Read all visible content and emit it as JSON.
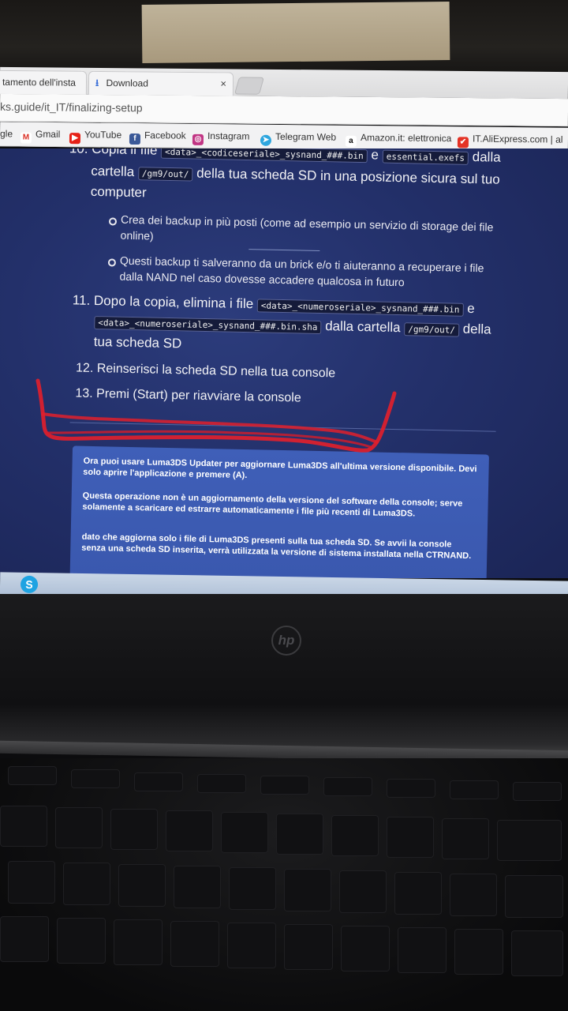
{
  "browser": {
    "tabs": [
      {
        "label": "tamento dell'insta"
      },
      {
        "label": "Download"
      }
    ],
    "tab_close_glyph": "×",
    "url": "ks.guide/it_IT/finalizing-setup",
    "bookmarks": [
      {
        "label": "gle",
        "icon": "google-icon"
      },
      {
        "label": "Gmail",
        "icon": "gmail-icon",
        "glyph": "M"
      },
      {
        "label": "YouTube",
        "icon": "youtube-icon"
      },
      {
        "label": "Facebook",
        "icon": "facebook-icon",
        "glyph": "f"
      },
      {
        "label": "Instagram",
        "icon": "instagram-icon"
      },
      {
        "label": "Telegram Web",
        "icon": "telegram-icon"
      },
      {
        "label": "Amazon.it: elettronica",
        "icon": "amazon-icon",
        "glyph": "a"
      },
      {
        "label": "IT.AliExpress.com | al",
        "icon": "aliexpress-icon"
      }
    ]
  },
  "guide": {
    "step10": {
      "line1_text": "10. Copia il file",
      "code1": "<data>_<codiceseriale>_sysnand_###.bin",
      "and": "e",
      "code2": "essential.exefs",
      "line1_end": "dalla",
      "line2_start": "cartella",
      "code3": "/gm9/out/",
      "line2_end": "della tua scheda SD in una posizione sicura sul tuo",
      "line3": "computer",
      "bullet1_line1": "Crea dei backup in più posti (come ad esempio un servizio di storage dei file",
      "bullet1_line2": "online)",
      "bullet2_line1": "Questi backup ti salveranno da un brick e/o ti aiuteranno a recuperare i file",
      "bullet2_line2": "dalla NAND nel caso dovesse accadere qualcosa in futuro"
    },
    "step11": {
      "line1_text": "11. Dopo la copia, elimina i file",
      "code1": "<data>_<numeroseriale>_sysnand_###.bin",
      "and": "e",
      "code2": "<data>_<numeroseriale>_sysnand_###.bin.sha",
      "mid": "dalla cartella",
      "code3": "/gm9/out/",
      "end": "della",
      "line3": "tua scheda SD"
    },
    "step12": "12. Reinserisci la scheda SD nella tua console",
    "step13": "13. Premi (Start) per riavviare la console",
    "note": {
      "p1": "Ora puoi usare Luma3DS Updater per aggiornare Luma3DS all'ultima versione disponibile. Devi solo aprire l'applicazione e premere (A).",
      "p2": "Questa operazione non è un aggiornamento della versione del software della console; serve solamente a scaricare ed estrarre automaticamente i file più recenti di Luma3DS.",
      "p3": "dato che aggiorna solo i file di Luma3DS presenti sulla tua scheda SD. Se avvii la console senza una scheda SD inserita, verrà utilizzata la versione di sistema installata nella CTRNAND."
    }
  },
  "taskbar": {
    "skype_glyph": "S"
  },
  "laptop": {
    "brand": "hp"
  },
  "colors": {
    "page_bg": "#23306a",
    "note_bg": "#3f5fb8",
    "annotation_red": "#e0202c"
  }
}
